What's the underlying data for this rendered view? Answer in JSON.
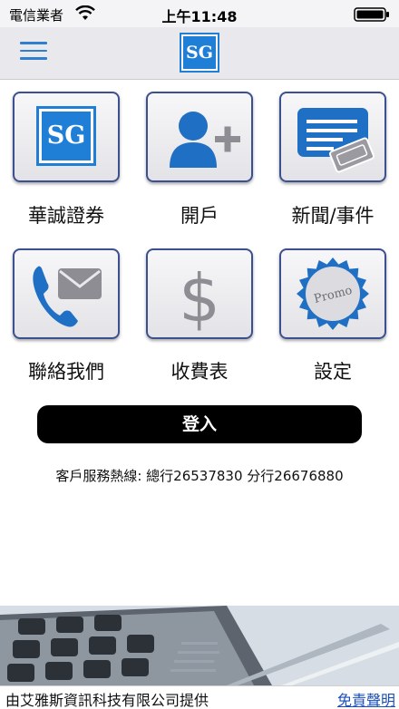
{
  "status_bar": {
    "carrier": "電信業者",
    "time": "上午11:48"
  },
  "nav": {
    "logo_text": "SG",
    "menu_icon": "hamburger-menu-icon"
  },
  "tiles": [
    {
      "label": "華誠證券",
      "icon": "sg-logo-icon"
    },
    {
      "label": "開戶",
      "icon": "add-user-icon"
    },
    {
      "label": "新聞/事件",
      "icon": "news-ticket-icon"
    },
    {
      "label": "聯絡我們",
      "icon": "phone-mail-icon"
    },
    {
      "label": "收費表",
      "icon": "dollar-icon"
    },
    {
      "label": "設定",
      "icon": "promo-badge-icon"
    }
  ],
  "tile_logo_text": "SG",
  "promo_text": "Promo",
  "login_label": "登入",
  "hotline": "客戶服務熱線: 總行26537830 分行26676880",
  "footer": {
    "provider": "由艾雅斯資訊科技有限公司提供",
    "disclaimer": "免責聲明"
  },
  "colors": {
    "brand_blue": "#1f7fd6",
    "tile_border": "#3c4f8f",
    "login_bg": "#000000"
  }
}
